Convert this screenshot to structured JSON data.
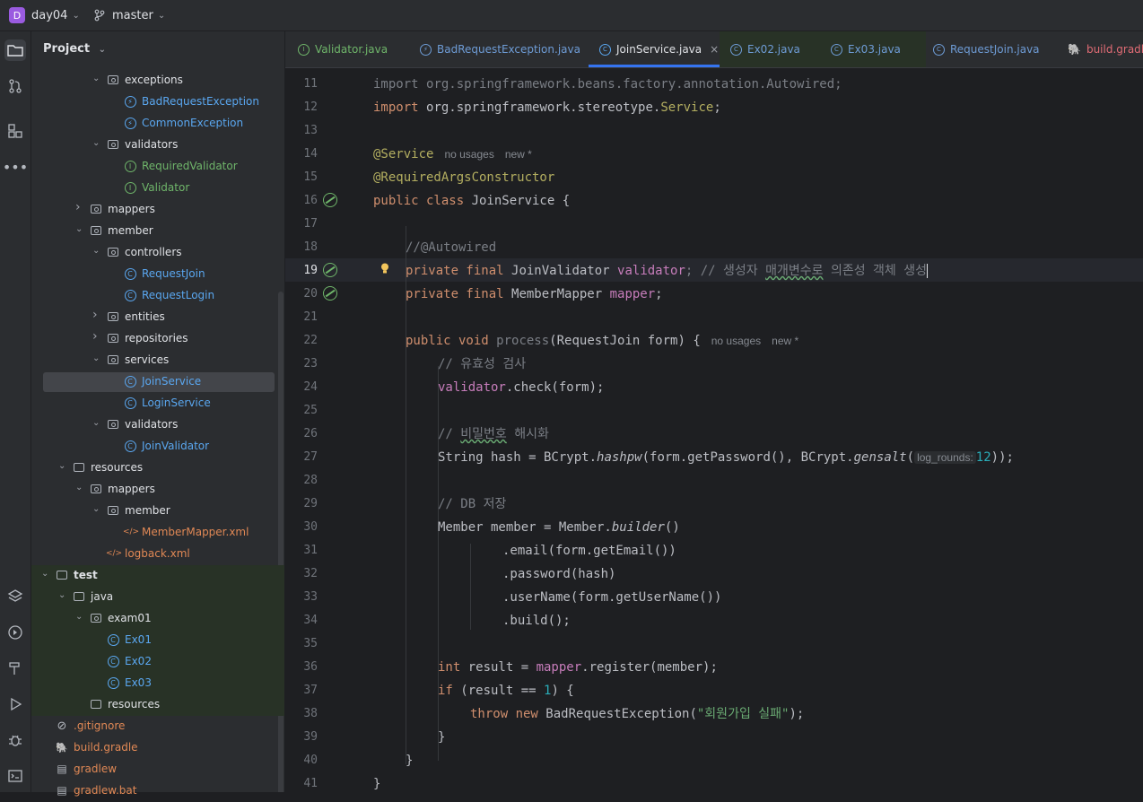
{
  "topbar": {
    "project_badge": "D",
    "project": "day04",
    "branch": "master"
  },
  "panel": {
    "title": "Project"
  },
  "tree": [
    {
      "label": "exceptions",
      "type": "folder",
      "color": "norm"
    },
    {
      "label": "BadRequestException",
      "type": "exception",
      "color": "blue"
    },
    {
      "label": "CommonException",
      "type": "exception",
      "color": "blue"
    },
    {
      "label": "validators",
      "type": "folder",
      "color": "norm"
    },
    {
      "label": "RequiredValidator",
      "type": "interface",
      "color": "green"
    },
    {
      "label": "Validator",
      "type": "interface",
      "color": "green"
    },
    {
      "label": "mappers",
      "type": "folder",
      "color": "norm"
    },
    {
      "label": "member",
      "type": "folder",
      "color": "norm"
    },
    {
      "label": "controllers",
      "type": "folder",
      "color": "norm"
    },
    {
      "label": "RequestJoin",
      "type": "class",
      "color": "blue"
    },
    {
      "label": "RequestLogin",
      "type": "class",
      "color": "blue"
    },
    {
      "label": "entities",
      "type": "folder",
      "color": "norm"
    },
    {
      "label": "repositories",
      "type": "folder",
      "color": "norm"
    },
    {
      "label": "services",
      "type": "folder",
      "color": "norm"
    },
    {
      "label": "JoinService",
      "type": "class",
      "color": "blue"
    },
    {
      "label": "LoginService",
      "type": "class",
      "color": "blue"
    },
    {
      "label": "validators",
      "type": "folder",
      "color": "norm"
    },
    {
      "label": "JoinValidator",
      "type": "class",
      "color": "blue"
    },
    {
      "label": "resources",
      "type": "folder",
      "color": "norm"
    },
    {
      "label": "mappers",
      "type": "folder",
      "color": "norm"
    },
    {
      "label": "member",
      "type": "folder",
      "color": "norm"
    },
    {
      "label": "MemberMapper.xml",
      "type": "xml",
      "color": "orange"
    },
    {
      "label": "logback.xml",
      "type": "xml",
      "color": "orange"
    },
    {
      "label": "test",
      "type": "folder",
      "color": "norm"
    },
    {
      "label": "java",
      "type": "folder",
      "color": "norm"
    },
    {
      "label": "exam01",
      "type": "folder",
      "color": "norm"
    },
    {
      "label": "Ex01",
      "type": "test",
      "color": "blue"
    },
    {
      "label": "Ex02",
      "type": "test",
      "color": "blue"
    },
    {
      "label": "Ex03",
      "type": "test",
      "color": "blue"
    },
    {
      "label": "resources",
      "type": "folder",
      "color": "norm"
    },
    {
      "label": ".gitignore",
      "type": "file",
      "color": "orange"
    },
    {
      "label": "build.gradle",
      "type": "gradle",
      "color": "orange"
    },
    {
      "label": "gradlew",
      "type": "file",
      "color": "orange"
    },
    {
      "label": "gradlew.bat",
      "type": "file",
      "color": "orange"
    }
  ],
  "tabs": [
    {
      "label": "Validator.java"
    },
    {
      "label": "BadRequestException.java"
    },
    {
      "label": "JoinService.java",
      "close": "×"
    },
    {
      "label": "Ex02.java"
    },
    {
      "label": "Ex03.java"
    },
    {
      "label": "RequestJoin.java"
    },
    {
      "label": "build.gradle"
    }
  ],
  "editor": {
    "line_numbers": [
      "11",
      "12",
      "13",
      "14",
      "15",
      "16",
      "17",
      "18",
      "19",
      "20",
      "21",
      "22",
      "23",
      "24",
      "25",
      "26",
      "27",
      "28",
      "29",
      "30",
      "31",
      "32",
      "33",
      "34",
      "35",
      "36",
      "37",
      "38",
      "39",
      "40",
      "41"
    ],
    "hints": {
      "service_usages": "no usages",
      "service_new": "new *",
      "process_usages": "no usages",
      "process_new": "new *",
      "log_rounds": "log_rounds:"
    },
    "code": {
      "l11a": "import ",
      "l11b": "org.springframework.beans.factory.annotation.Autowired;",
      "l12a": "import ",
      "l12b": "org.springframework.stereotype.",
      "l12c": "Service",
      "l12d": ";",
      "l14": "@Service",
      "l15": "@RequiredArgsConstructor",
      "l16a": "public class ",
      "l16b": "JoinService {",
      "l18": "//@Autowired",
      "l19a": "private final ",
      "l19b": "JoinValidator ",
      "l19c": "validator",
      "l19d": "; // 생성자 ",
      "l19e": "매개변수로",
      "l19f": " 의존성 객체 생성",
      "l20a": "private final ",
      "l20b": "MemberMapper ",
      "l20c": "mapper",
      "l20d": ";",
      "l22a": "public void ",
      "l22b": "process",
      "l22c": "(RequestJoin form) {",
      "l23": "// 유효성 검사",
      "l24a": "validator",
      "l24b": ".check(form);",
      "l26a": "// ",
      "l26b": "비밀번호",
      "l26c": " 해시화",
      "l27a": "String hash = BCrypt.",
      "l27b": "hashpw",
      "l27c": "(form.getPassword(), BCrypt.",
      "l27d": "gensalt",
      "l27e": "(",
      "l27f": "12",
      "l27g": "));",
      "l29": "// DB 저장",
      "l30a": "Member member = Member.",
      "l30b": "builder",
      "l30c": "()",
      "l31": ".email(form.getEmail())",
      "l32": ".password(hash)",
      "l33": ".userName(form.getUserName())",
      "l34": ".build();",
      "l36a": "int ",
      "l36b": "result = ",
      "l36c": "mapper",
      "l36d": ".register(member);",
      "l37a": "if ",
      "l37b": "(result == ",
      "l37c": "1",
      "l37d": ") {",
      "l38a": "throw new ",
      "l38b": "BadRequestException(",
      "l38c": "\"회원가입 실패\"",
      "l38d": ");",
      "l39": "}",
      "l40": "}",
      "l41": "}"
    }
  }
}
